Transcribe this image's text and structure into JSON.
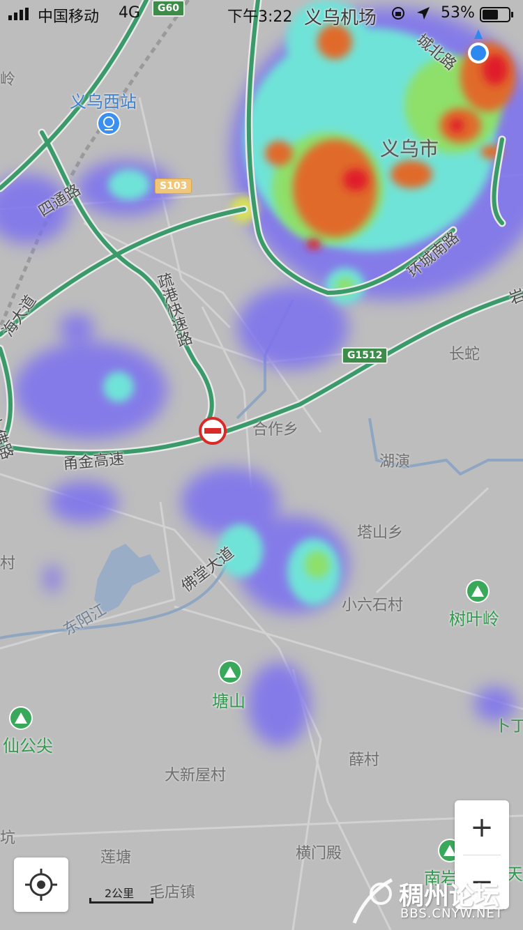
{
  "status_bar": {
    "carrier": "中国移动",
    "network": "4G",
    "time": "下午3:22",
    "battery": "53%"
  },
  "map": {
    "city": "义乌市",
    "train_station": "义乌西站",
    "airport": "义乌机场",
    "roads": {
      "sitong": "四通路",
      "shugang": "疏港快速路",
      "huancheng": "环城南路",
      "chengbei": "城北路",
      "yongjin": "甬金高速",
      "fotang": "佛堂大道",
      "shangfo": "上佛路",
      "hai_dadao": "海大道",
      "yan_edge": "岩",
      "ling_edge": "岭"
    },
    "shields": {
      "g60": "G60",
      "s103": "S103",
      "g1512": "G1512"
    },
    "places": {
      "hezuo": "合作乡",
      "changshe": "长蛇",
      "huyan": "湖演",
      "tashan": "塔山乡",
      "xiaoliushi": "小六石村",
      "dongyang_river": "东阳江",
      "daxinwu": "大新屋村",
      "xuecun": "薛村",
      "liantang": "莲塘",
      "hengmendian": "横门殿",
      "maodian": "毛店镇",
      "keng": "坑",
      "cun_edge": "村",
      "bu_edge": "卜丁"
    },
    "mountains": {
      "shuyeling": "树叶岭",
      "tangshan": "塘山",
      "xiangongjian": "仙公尖",
      "nanyan": "南岩",
      "tian_edge": "天"
    },
    "scale": "2公里"
  },
  "controls": {
    "zoom_in": "+",
    "zoom_out": "−"
  },
  "watermark": {
    "title": "稠州论坛",
    "url": "BBS.CNYW.NET"
  },
  "colors": {
    "land": "#bdbdbd",
    "highway": "#3a9a6a",
    "heat_low": "#7b6ff0",
    "heat_mid": "#6fe3d8",
    "heat_high": "#e06a2a",
    "heat_peak": "#e01c2a",
    "location_dot": "#2d89f0"
  }
}
